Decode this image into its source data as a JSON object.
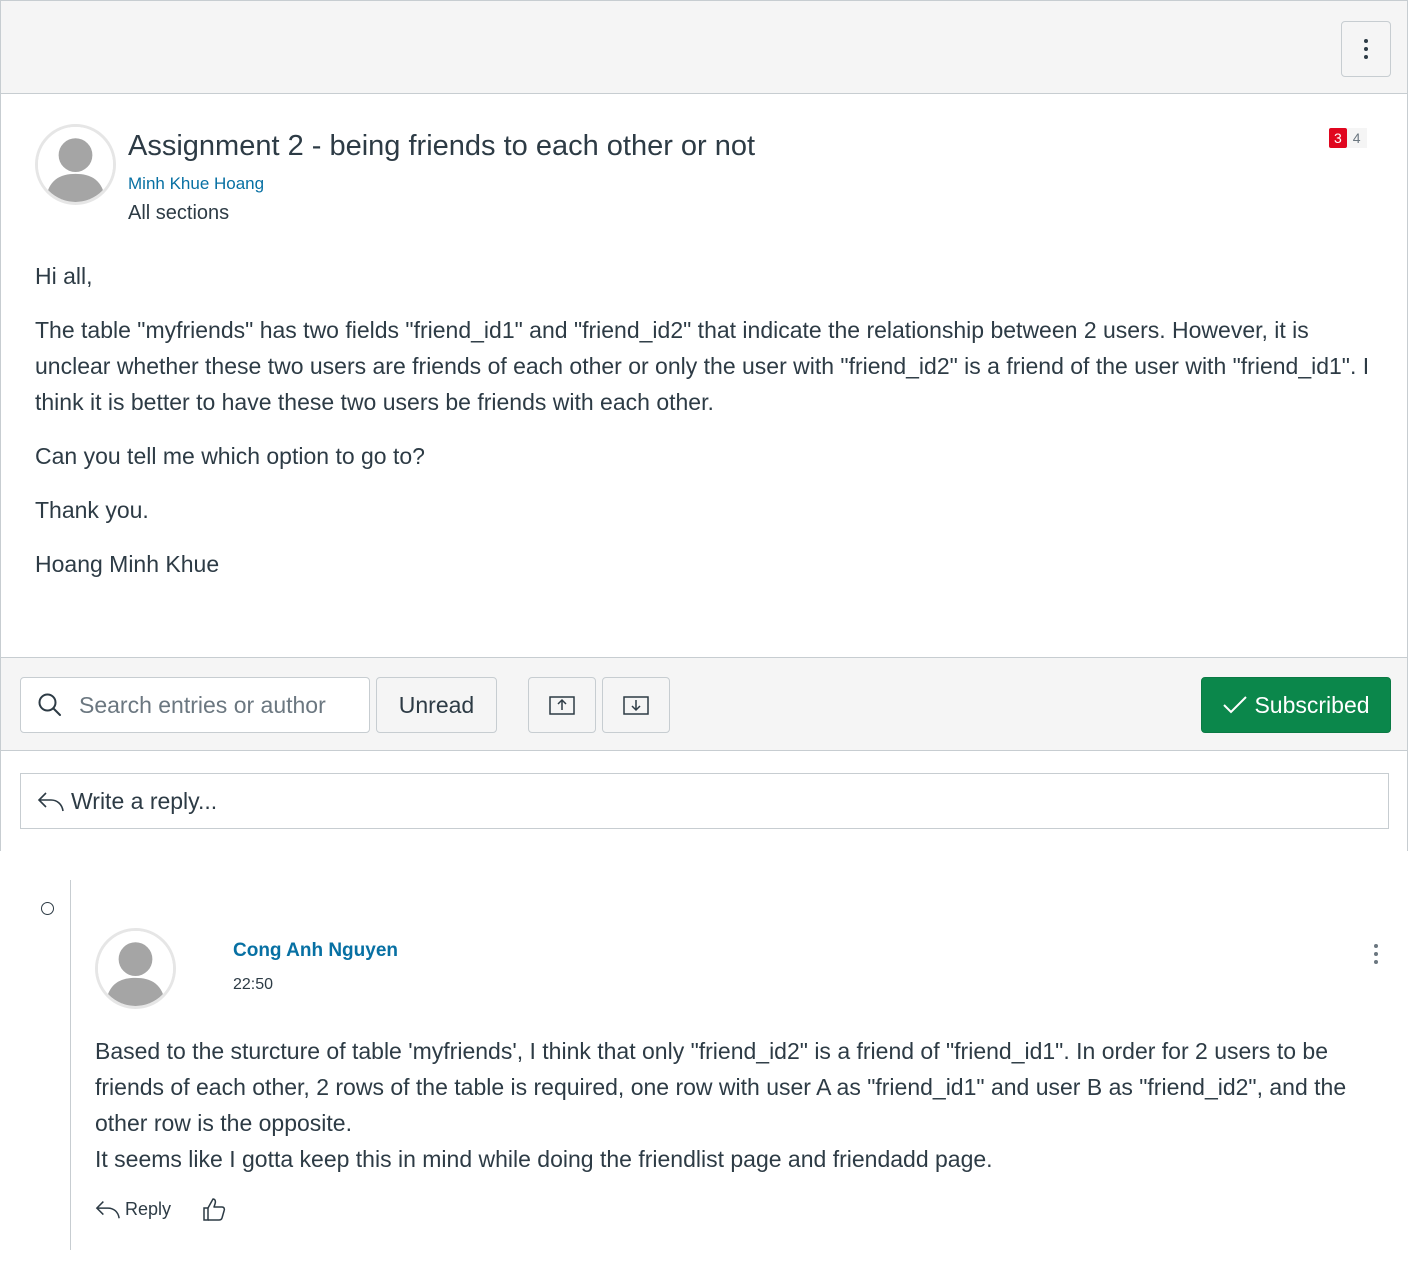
{
  "topic": {
    "title": "Assignment 2 - being friends to each other or not",
    "author": "Minh Khue Hoang",
    "sections": "All sections",
    "unread_count": "3",
    "total_count": "4",
    "message": [
      "Hi all,",
      "The table \"myfriends\" has two fields \"friend_id1\" and \"friend_id2\" that indicate the relationship between 2 users. However, it is unclear whether these two users are friends of each other or only the user with \"friend_id2\" is a friend of the user with \"friend_id1\". I think it is better to have these two users be friends with each other.",
      "Can you tell me which option to go to?",
      "Thank you.",
      "Hoang Minh Khue"
    ]
  },
  "toolbar": {
    "search_placeholder": "Search entries or author",
    "unread_label": "Unread",
    "subscribed_label": "Subscribed"
  },
  "reply_bar": {
    "label": "Write a reply..."
  },
  "entry": {
    "author": "Cong Anh Nguyen",
    "time": "22:50",
    "message": [
      "Based to the sturcture of table 'myfriends', I think that only \"friend_id2\" is a friend of \"friend_id1\". In order for 2 users to be friends of each other, 2 rows of the table is required, one row with user A as \"friend_id1\" and user B as \"friend_id2\", and the other row is the opposite.",
      "It seems like I gotta keep this in mind while doing the friendlist page and friendadd page."
    ],
    "reply_label": "Reply"
  },
  "colors": {
    "accent_link": "#0770a3",
    "subscribed_green": "#0b874b",
    "unread_badge": "#e0061f"
  },
  "icons": [
    "kebab-icon",
    "avatar-placeholder",
    "search-icon",
    "collapse-icon",
    "expand-icon",
    "checkmark-icon",
    "reply-arrow-icon",
    "unread-indicator",
    "like-icon"
  ]
}
